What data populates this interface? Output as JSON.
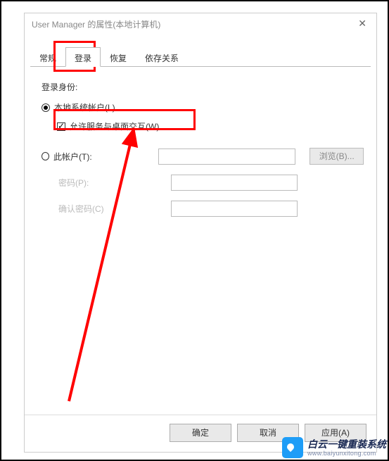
{
  "window": {
    "title": "User Manager 的属性(本地计算机)"
  },
  "tabs": {
    "general": "常规",
    "logon": "登录",
    "recovery": "恢复",
    "dependencies": "依存关系"
  },
  "logon": {
    "logon_as_label": "登录身份:",
    "local_system": "本地系统帐户(L)",
    "allow_interact": "允许服务与桌面交互(W)",
    "this_account": "此帐户(T):",
    "browse": "浏览(B)...",
    "password": "密码(P):",
    "confirm_password": "确认密码(C)"
  },
  "buttons": {
    "ok": "确定",
    "cancel": "取消",
    "apply": "应用(A)"
  },
  "watermark": {
    "line1": "白云一键重装系统",
    "url": "www.baiyunxitong.com"
  }
}
